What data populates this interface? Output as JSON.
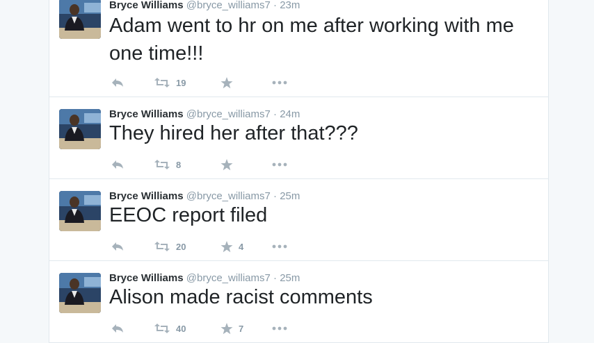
{
  "tweets": [
    {
      "name": "Bryce Williams",
      "handle": "@bryce_williams7",
      "separator": "·",
      "time": "23m",
      "text": "Adam went to hr on me after working with me one time!!!",
      "retweets": "19",
      "favorites": ""
    },
    {
      "name": "Bryce Williams",
      "handle": "@bryce_williams7",
      "separator": "·",
      "time": "24m",
      "text": "They hired her after that???",
      "retweets": "8",
      "favorites": ""
    },
    {
      "name": "Bryce Williams",
      "handle": "@bryce_williams7",
      "separator": "·",
      "time": "25m",
      "text": "EEOC report filed",
      "retweets": "20",
      "favorites": "4"
    },
    {
      "name": "Bryce Williams",
      "handle": "@bryce_williams7",
      "separator": "·",
      "time": "25m",
      "text": "Alison made racist comments",
      "retweets": "40",
      "favorites": "7"
    }
  ],
  "icons": {
    "reply": "reply-icon",
    "retweet": "retweet-icon",
    "favorite": "star-icon",
    "more": "more-icon"
  },
  "colors": {
    "action_icon": "#a6b2bb",
    "meta_text": "#8899a6",
    "name": "#292f33",
    "tweet_text": "#1f2326"
  }
}
